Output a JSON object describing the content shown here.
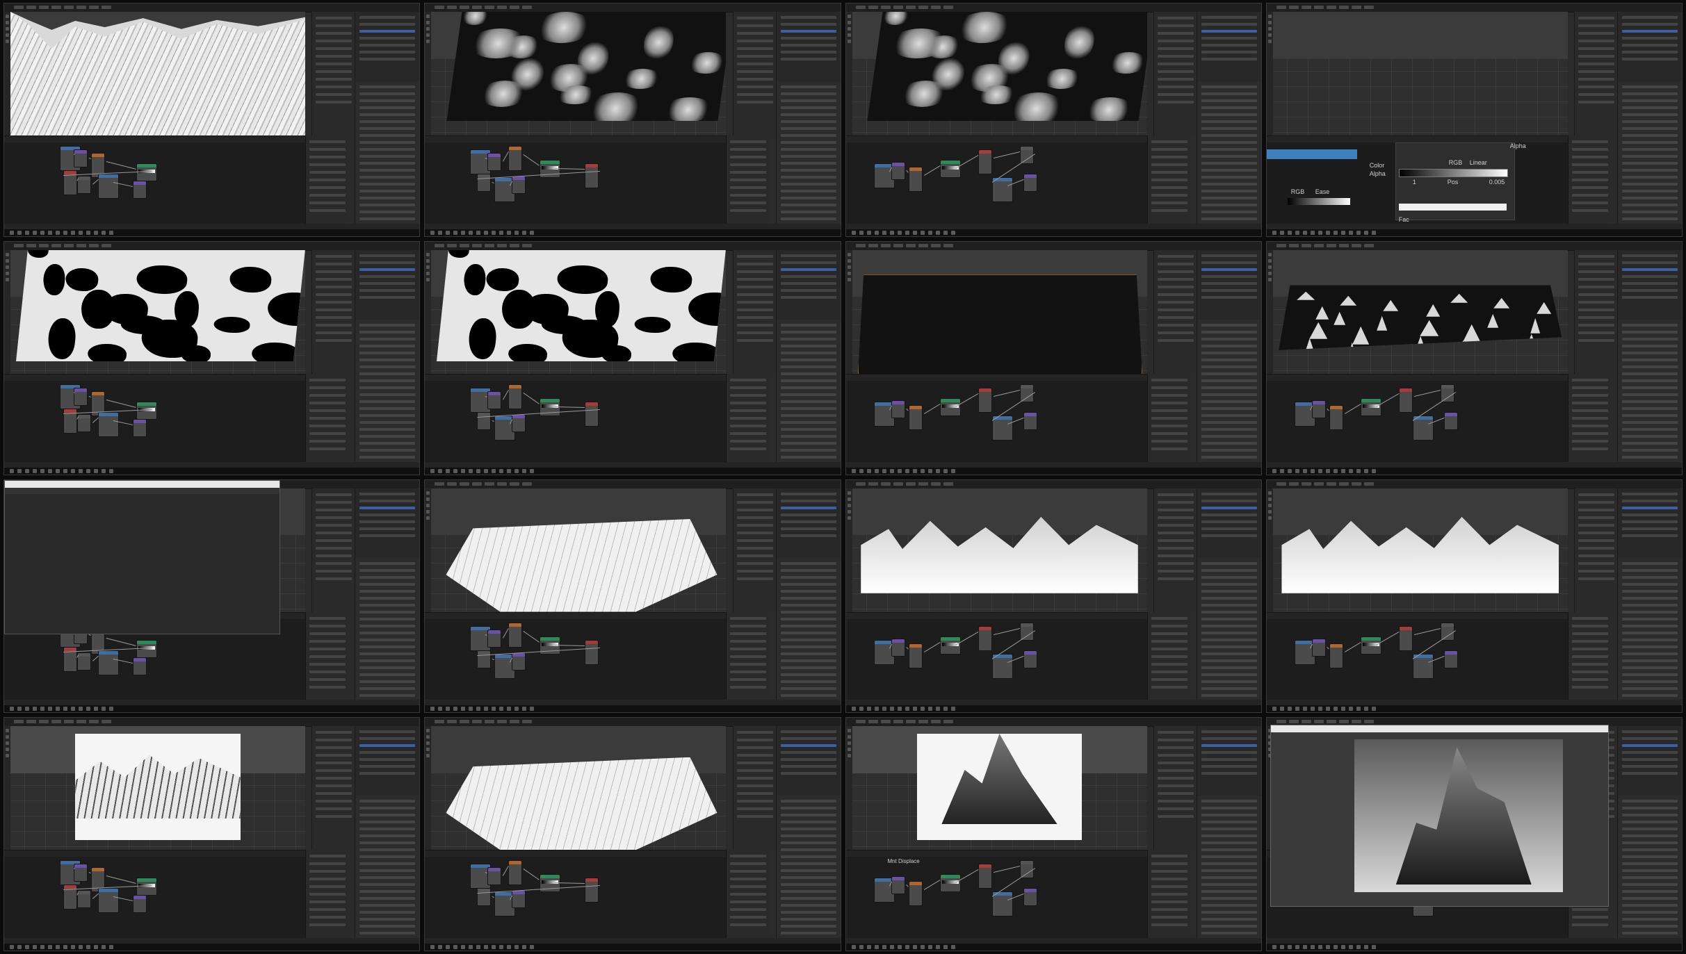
{
  "frames": [
    {
      "variant": "mountains-wire"
    },
    {
      "variant": "clouds"
    },
    {
      "variant": "clouds2"
    },
    {
      "variant": "ramp"
    },
    {
      "variant": "cow"
    },
    {
      "variant": "cow"
    },
    {
      "variant": "dark"
    },
    {
      "variant": "spiky"
    },
    {
      "variant": "console"
    },
    {
      "variant": "white-mtn"
    },
    {
      "variant": "grey-mtn"
    },
    {
      "variant": "grey-mtn"
    },
    {
      "variant": "framed"
    },
    {
      "variant": "white-persp"
    },
    {
      "variant": "peak-framed"
    },
    {
      "variant": "render"
    }
  ],
  "ramp_popup": {
    "alpha_label": "Alpha",
    "color_label": "Color",
    "alpha_socket": "Alpha",
    "color_mode": "RGB",
    "interpolation": "Linear",
    "index": "1",
    "pos_label": "Pos",
    "pos_value": "0.005",
    "fac_label": "Fac",
    "color_mode_2": "RGB",
    "interp_2": "Ease"
  },
  "node_label_15": "Mnt Displace",
  "colors": {
    "accent": "#3d7fbf",
    "node_blue": "#3f6ea3",
    "node_purple": "#6c4fa7",
    "node_orange": "#b0672b",
    "node_green": "#2f8a5b",
    "node_red": "#a73a3a"
  },
  "icons": [
    "add-object-icon",
    "move-tool-icon",
    "rotate-tool-icon",
    "scale-tool-icon",
    "cursor-icon",
    "taskbar-app-icon"
  ]
}
